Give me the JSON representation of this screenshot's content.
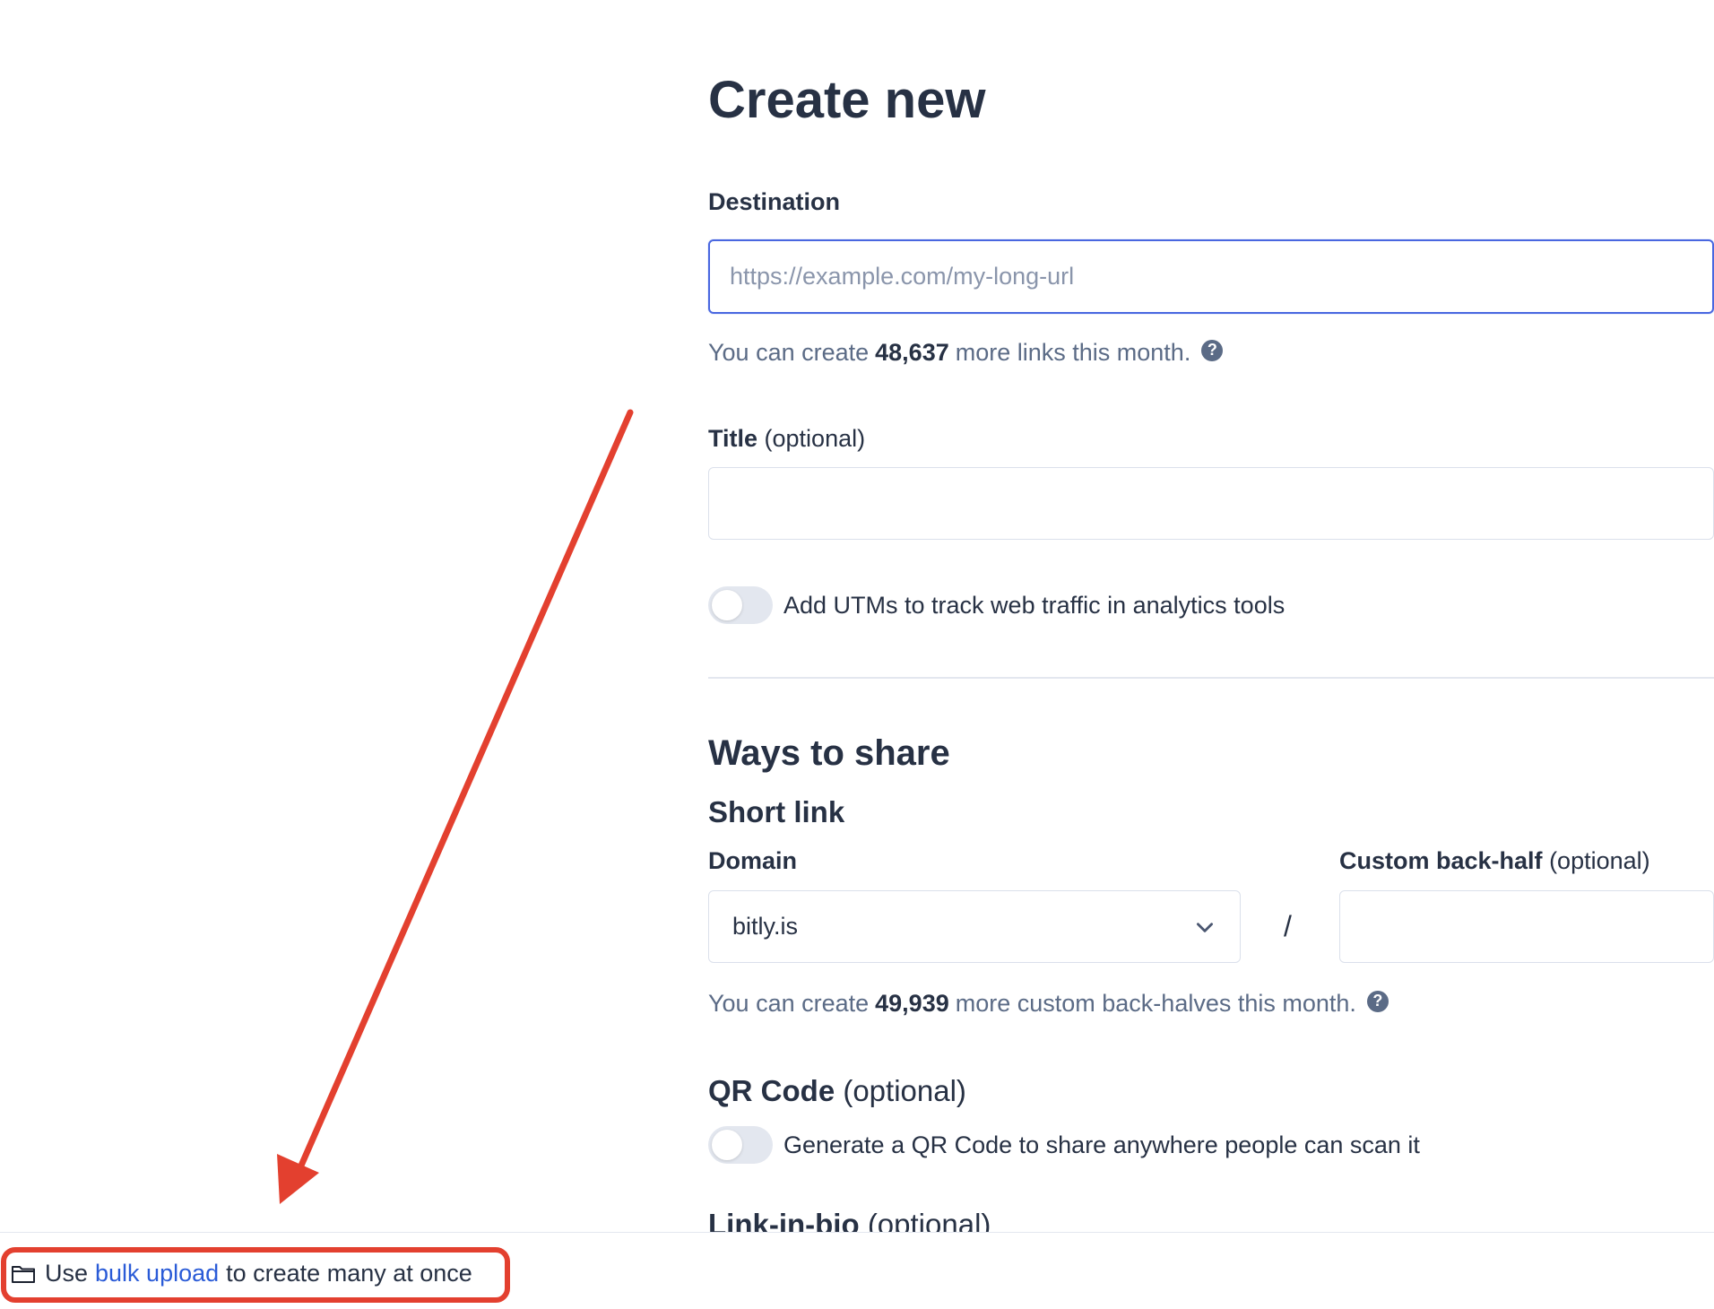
{
  "form": {
    "title": "Create new",
    "destination": {
      "label": "Destination",
      "placeholder": "https://example.com/my-long-url",
      "quota_prefix": "You can create",
      "quota_count": "48,637",
      "quota_suffix": "more links this month."
    },
    "title_field": {
      "label": "Title",
      "optional": "(optional)"
    },
    "utm_toggle": {
      "label": "Add UTMs to track web traffic in analytics tools",
      "on": false
    },
    "ways_to_share": {
      "heading": "Ways to share",
      "short_link": {
        "heading": "Short link",
        "domain_label": "Domain",
        "domain_value": "bitly.is",
        "separator": "/",
        "backhalf_label": "Custom back-half",
        "backhalf_optional": "(optional)",
        "quota_prefix": "You can create",
        "quota_count": "49,939",
        "quota_suffix": "more custom back-halves this month."
      },
      "qr_code": {
        "heading": "QR Code",
        "optional": "(optional)",
        "toggle_label": "Generate a QR Code to share anywhere people can scan it",
        "on": false
      },
      "link_in_bio": {
        "heading": "Link-in-bio",
        "optional": "(optional)"
      }
    }
  },
  "footer": {
    "prefix": "Use",
    "link": "bulk upload",
    "suffix": "to create many at once"
  },
  "annotation": {
    "color": "#e3402f"
  },
  "icons": {
    "help": "?",
    "folder": "folder-icon",
    "chevron": "chevron-down-icon"
  }
}
